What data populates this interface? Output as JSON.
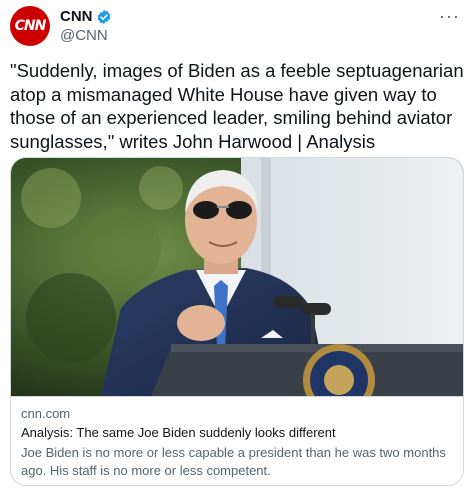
{
  "tweet": {
    "avatar_text": "CNN",
    "display_name": "CNN",
    "handle": "@CNN",
    "more_icon": "more-options-icon",
    "verified_icon": "verified-badge-icon",
    "text": "\"Suddenly, images of Biden as a feeble septuagenarian atop a mismanaged White House have given way to those of an experienced leader, smiling behind aviator sunglasses,\" writes John Harwood | Analysis"
  },
  "card": {
    "domain": "cnn.com",
    "title": "Analysis: The same Joe Biden suddenly looks different",
    "description": "Joe Biden is no more or less capable a president than he was two months ago. His staff is no more or less competent."
  },
  "colors": {
    "brand_red": "#cc0000",
    "verified_blue": "#1d9bf0",
    "text_primary": "#0f1419",
    "text_secondary": "#536471",
    "border": "#cfd9de"
  }
}
